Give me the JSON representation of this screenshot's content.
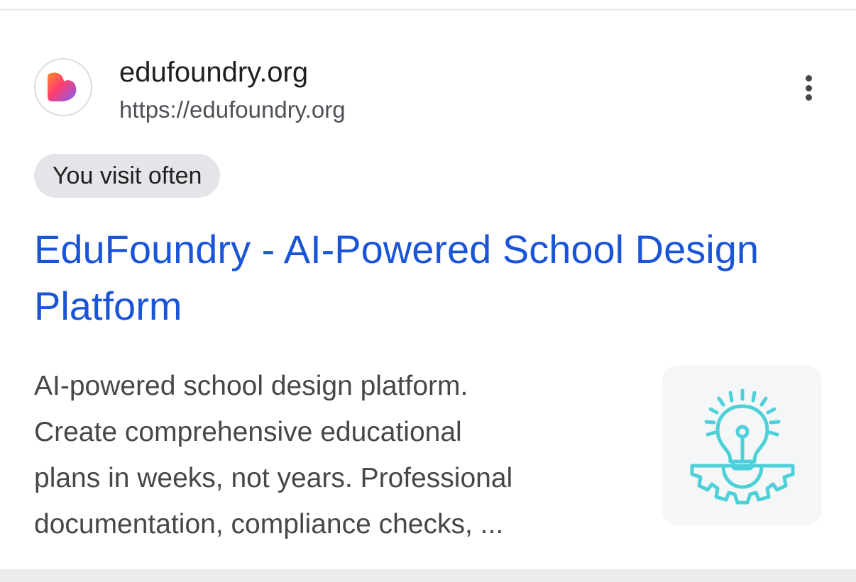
{
  "result": {
    "site_name": "edufoundry.org",
    "site_url": "https://edufoundry.org",
    "badge": "You visit often",
    "title": "EduFoundry - AI-Powered School Design Platform",
    "snippet_lines": [
      "AI-powered school design platform.",
      "Create comprehensive educational",
      "plans in weeks, not years. Professional",
      "documentation, compliance checks, ..."
    ],
    "favicon_icon": "heart-logo-icon",
    "thumbnail_icon": "lightbulb-gear-icon",
    "menu_icon": "more-vert-icon"
  },
  "colors": {
    "title_link": "#1a55d8",
    "snippet_text": "#474747",
    "badge_bg": "#e3e5e8",
    "thumbnail_stroke": "#4dd0d8"
  }
}
